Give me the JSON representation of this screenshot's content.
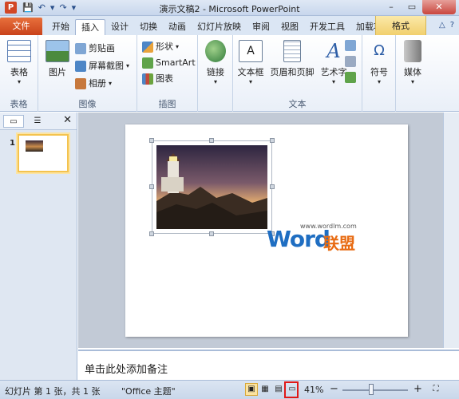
{
  "title_bar": {
    "app_icon": "P",
    "title": "演示文稿2 - Microsoft PowerPoint",
    "qat_icons": [
      "save-icon",
      "undo-icon",
      "redo-icon",
      "customize-icon"
    ],
    "qat_glyphs": {
      "save": "💾",
      "undo": "↶",
      "undo_dd": "▾",
      "redo": "↷",
      "customize": "▾"
    },
    "window_buttons": {
      "minimize": "–",
      "maximize": "▭",
      "close": "✕"
    }
  },
  "tabs": {
    "file": "文件",
    "items": [
      "开始",
      "插入",
      "设计",
      "切换",
      "动画",
      "幻灯片放映",
      "审阅",
      "视图",
      "开发工具",
      "加载项"
    ],
    "active": "插入",
    "context_tab": "格式",
    "ribbon_controls": {
      "minimize": "△",
      "help": "?"
    }
  },
  "ribbon": {
    "groups": {
      "tables": {
        "label": "表格",
        "table_button": "表格"
      },
      "images": {
        "label": "图像",
        "picture": "图片",
        "clipart": "剪贴画",
        "screenshot": "屏幕截图",
        "album": "相册"
      },
      "illustrations": {
        "label": "插图",
        "shapes": "形状",
        "smartart": "SmartArt",
        "chart": "图表"
      },
      "links": {
        "label": "",
        "link": "链接"
      },
      "text": {
        "label": "文本",
        "textbox": "文本框",
        "header_footer": "页眉和页脚",
        "wordart": "艺术字"
      },
      "symbols": {
        "label": "",
        "symbol": "符号"
      },
      "media": {
        "label": "",
        "media": "媒体"
      }
    },
    "dropdown_arrow": "▾"
  },
  "left_pane": {
    "slide_number": "1",
    "close": "✕"
  },
  "slide": {
    "watermark_url": "www.wordlm.com",
    "watermark_word": "Word",
    "watermark_lm": "联盟"
  },
  "notes": {
    "placeholder": "单击此处添加备注"
  },
  "status_bar": {
    "slide_info": "幻灯片 第 1 张，共 1 张",
    "theme": "\"Office 主题\"",
    "zoom": "41%",
    "zoom_out": "−",
    "zoom_in": "+"
  },
  "colors": {
    "file_tab": "#d24726",
    "ribbon_bg": "#e9eff8",
    "highlight": "#e01818",
    "watermark_blue": "#1f6ec2",
    "watermark_orange": "#e86b12"
  }
}
